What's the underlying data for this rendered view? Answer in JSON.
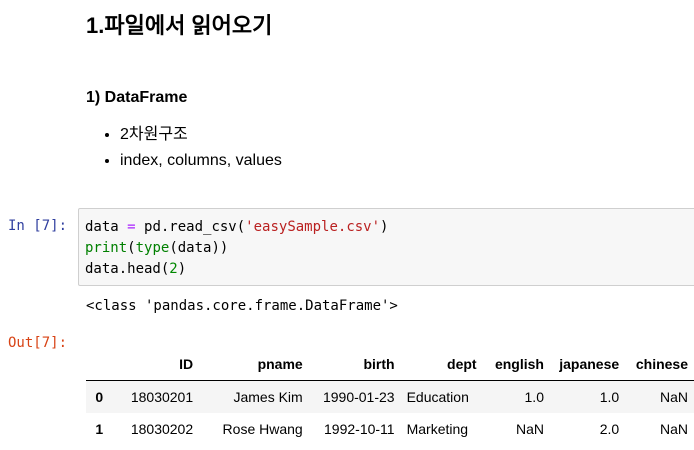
{
  "markdown": {
    "heading1": "1.파일에서 읽어오기",
    "heading3": "1) DataFrame",
    "bullets": [
      "2차원구조",
      "index, columns, values"
    ]
  },
  "code_cell": {
    "prompt": "In [7]:",
    "lines": [
      {
        "tokens": [
          {
            "text": "data ",
            "type": "plain"
          },
          {
            "text": "=",
            "type": "op"
          },
          {
            "text": " pd.read_csv(",
            "type": "plain"
          },
          {
            "text": "'easySample.csv'",
            "type": "str"
          },
          {
            "text": ")",
            "type": "plain"
          }
        ]
      },
      {
        "tokens": [
          {
            "text": "print",
            "type": "builtin"
          },
          {
            "text": "(",
            "type": "plain"
          },
          {
            "text": "type",
            "type": "builtin"
          },
          {
            "text": "(data))",
            "type": "plain"
          }
        ]
      },
      {
        "tokens": [
          {
            "text": "data.head(",
            "type": "plain"
          },
          {
            "text": "2",
            "type": "num"
          },
          {
            "text": ")",
            "type": "plain"
          }
        ]
      }
    ]
  },
  "output": {
    "stdout": "<class 'pandas.core.frame.DataFrame'>",
    "prompt": "Out[7]:",
    "table": {
      "columns": [
        "ID",
        "pname",
        "birth",
        "dept",
        "english",
        "japanese",
        "chinese"
      ],
      "rows": [
        {
          "index": "0",
          "cells": [
            "18030201",
            "James Kim",
            "1990-01-23",
            "Education",
            "1.0",
            "1.0",
            "NaN"
          ]
        },
        {
          "index": "1",
          "cells": [
            "18030202",
            "Rose Hwang",
            "1992-10-11",
            "Marketing",
            "NaN",
            "2.0",
            "NaN"
          ]
        }
      ]
    }
  },
  "colors": {
    "in_prompt": "#303f9f",
    "out_prompt": "#d84315",
    "string": "#ba2121",
    "number": "#008800",
    "builtin": "#008000",
    "operator": "#aa22ff",
    "code_background": "#f7f7f7",
    "row_stripe": "#f5f5f5"
  }
}
